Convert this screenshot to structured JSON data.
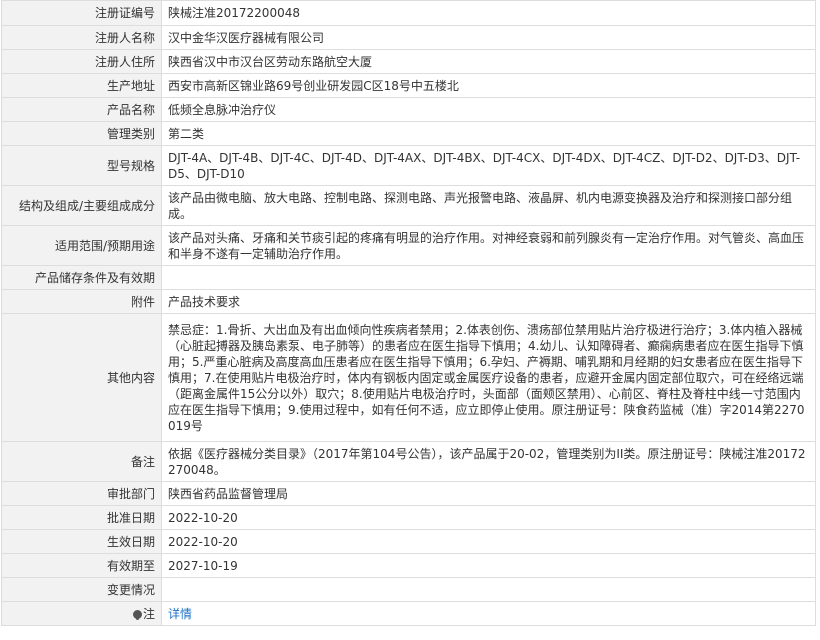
{
  "rows": [
    {
      "label": "注册证编号",
      "value": "陕械注准20172200048"
    },
    {
      "label": "注册人名称",
      "value": "汉中金华汉医疗器械有限公司"
    },
    {
      "label": "注册人住所",
      "value": "陕西省汉中市汉台区劳动东路航空大厦"
    },
    {
      "label": "生产地址",
      "value": "西安市高新区锦业路69号创业研发园C区18号中五楼北"
    },
    {
      "label": "产品名称",
      "value": "低频全息脉冲治疗仪"
    },
    {
      "label": "管理类别",
      "value": "第二类"
    },
    {
      "label": "型号规格",
      "value": "DJT-4A、DJT-4B、DJT-4C、DJT-4D、DJT-4AX、DJT-4BX、DJT-4CX、DJT-4DX、DJT-4CZ、DJT-D2、DJT-D3、DJT-D5、DJT-D10"
    },
    {
      "label": "结构及组成/主要组成成分",
      "value": "该产品由微电脑、放大电路、控制电路、探测电路、声光报警电路、液晶屏、机内电源变换器及治疗和探测接口部分组成。"
    },
    {
      "label": "适用范围/预期用途",
      "value": "该产品对头痛、牙痛和关节痰引起的疼痛有明显的治疗作用。对神经衰弱和前列腺炎有一定治疗作用。对气管炎、高血压和半身不遂有一定辅助治疗作用。"
    },
    {
      "label": "产品储存条件及有效期",
      "value": ""
    },
    {
      "label": "附件",
      "value": "产品技术要求"
    },
    {
      "label": "其他内容",
      "value": "禁忌症：1.骨折、大出血及有出血倾向性疾病者禁用；2.体表创伤、溃疡部位禁用贴片治疗极进行治疗；3.体内植入器械（心脏起搏器及胰岛素泵、电子肺等）的患者应在医生指导下慎用；4.幼儿、认知障碍者、癫痫病患者应在医生指导下慎用；5.严重心脏病及高度高血压患者应在医生指导下慎用；6.孕妇、产褥期、哺乳期和月经期的妇女患者应在医生指导下慎用；7.在使用贴片电极治疗时，体内有钢板内固定或金属医疗设备的患者，应避开金属内固定部位取穴，可在经络远端（距离金属件15公分以外）取穴；8.使用贴片电极治疗时，头面部（面颊区禁用）、心前区、脊柱及脊柱中线一寸范围内应在医生指导下慎用；9.使用过程中，如有任何不适，应立即停止使用。原注册证号：陕食药监械（准）字2014第2270019号"
    },
    {
      "label": "备注",
      "value": "依据《医疗器械分类目录》（2017年第104号公告），该产品属于20-02，管理类别为II类。原注册证号：陕械注准20172270048。"
    },
    {
      "label": "审批部门",
      "value": "陕西省药品监督管理局"
    },
    {
      "label": "批准日期",
      "value": "2022-10-20"
    },
    {
      "label": "生效日期",
      "value": "2022-10-20"
    },
    {
      "label": "有效期至",
      "value": "2027-10-19"
    },
    {
      "label": "变更情况",
      "value": ""
    }
  ],
  "note": {
    "label": "注",
    "link_text": "详情",
    "icon": "bell-icon"
  }
}
